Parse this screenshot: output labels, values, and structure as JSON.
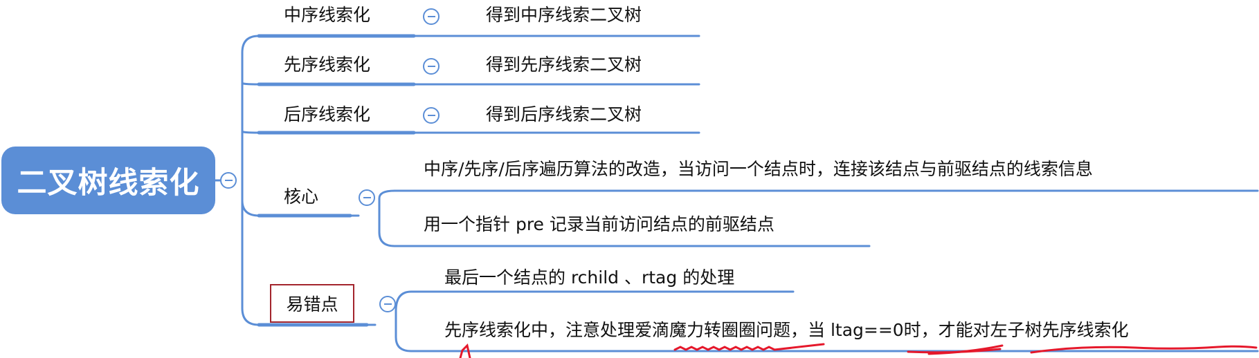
{
  "root": {
    "label": "二叉树线索化"
  },
  "branches": [
    {
      "label": "中序线索化",
      "children": [
        "得到中序线索二叉树"
      ]
    },
    {
      "label": "先序线索化",
      "children": [
        "得到先序线索二叉树"
      ]
    },
    {
      "label": "后序线索化",
      "children": [
        "得到后序线索二叉树"
      ]
    },
    {
      "label": "核心",
      "children": [
        "中序/先序/后序遍历算法的改造，当访问一个结点时，连接该结点与前驱结点的线索信息",
        "用一个指针 pre 记录当前访问结点的前驱结点"
      ]
    },
    {
      "label": "易错点",
      "children": [
        "最后一个结点的 rchild 、rtag 的处理",
        "先序线索化中，注意处理爱滴魔力转圈圈问题，当 ltag==0时，才能对左子树先序线索化"
      ]
    }
  ],
  "colors": {
    "accent": "#5b8ed6",
    "highlight_box": "#a3242c",
    "annotation": "#e5182b"
  },
  "icons": {
    "collapse": "collapse-minus-icon"
  }
}
